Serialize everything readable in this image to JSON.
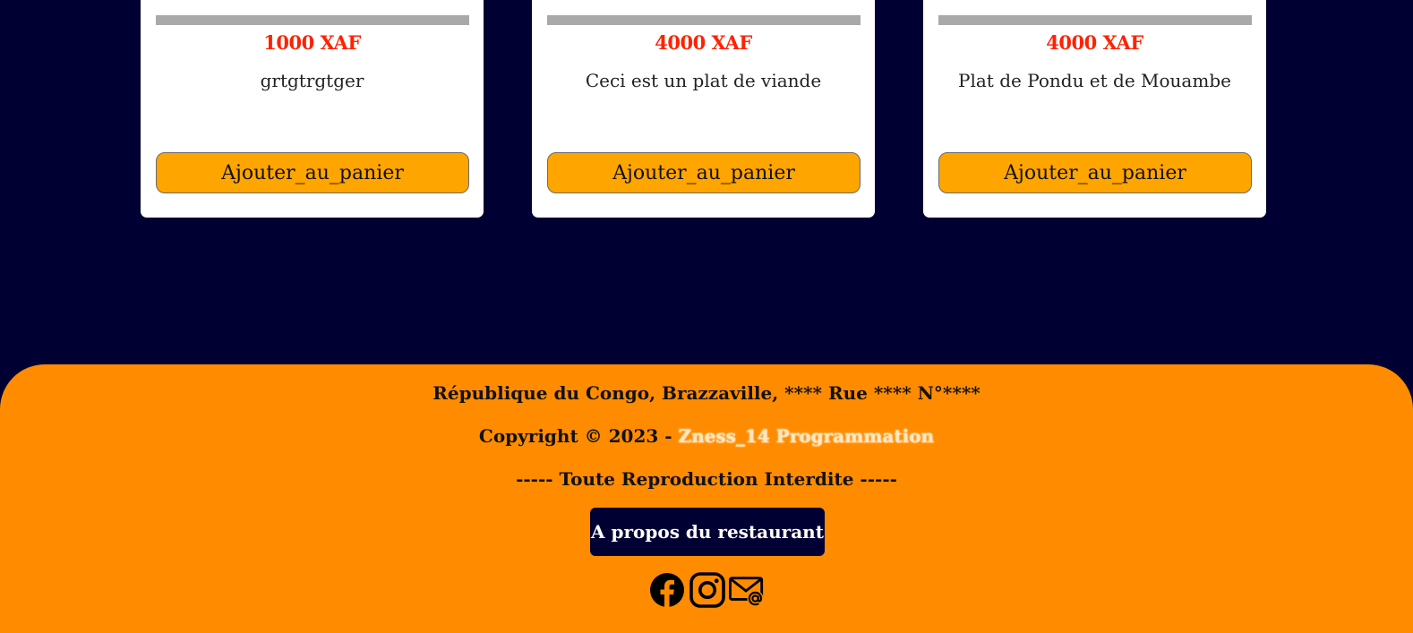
{
  "products": [
    {
      "price": "1000 XAF",
      "description": "grtgtrgtger",
      "button_label": "Ajouter_au_panier"
    },
    {
      "price": "4000 XAF",
      "description": "Ceci est un plat de viande",
      "button_label": "Ajouter_au_panier"
    },
    {
      "price": "4000 XAF",
      "description": "Plat de Pondu et de Mouambe",
      "button_label": "Ajouter_au_panier"
    }
  ],
  "footer": {
    "address": "République du Congo, Brazzaville, **** Rue **** N°****",
    "copyright_prefix": "Copyright © 2023 - ",
    "brand": "Zness_14 Programmation",
    "reproduction_notice": "----- Toute Reproduction Interdite -----",
    "about_button": "A propos du restaurant",
    "social_icons": [
      "facebook-icon",
      "instagram-icon",
      "email-icon"
    ]
  },
  "colors": {
    "page_background": "#000033",
    "footer_background": "#ff8c00",
    "price_color": "#ff2200",
    "button_color": "#ffa500"
  }
}
